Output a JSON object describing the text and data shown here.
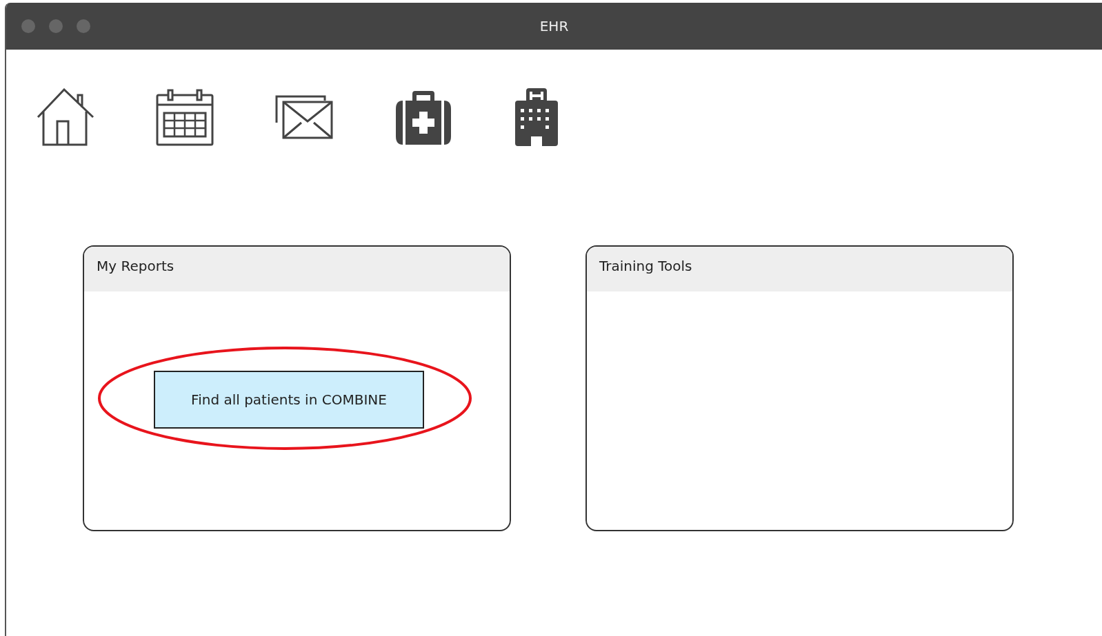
{
  "window": {
    "title": "EHR"
  },
  "toolbar": [
    {
      "kind": "home"
    },
    {
      "kind": "calendar"
    },
    {
      "kind": "mail"
    },
    {
      "kind": "medkit"
    },
    {
      "kind": "hospital"
    }
  ],
  "panels": [
    {
      "title": "My Reports",
      "button": {
        "label": "Find all patients in COMBINE",
        "highlighted": true
      }
    },
    {
      "title": "Training Tools"
    }
  ]
}
